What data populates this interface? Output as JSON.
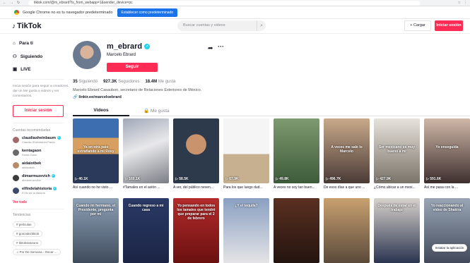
{
  "browser": {
    "url": "tiktok.com/@m_ebrard?is_from_webapp=1&sender_device=pc"
  },
  "infobar": {
    "text": "Google Chrome no es tu navegador predeterminado",
    "button": "Establecer como predeterminado"
  },
  "header": {
    "logo": "TikTok",
    "search_placeholder": "Buscar cuentas y videos",
    "upload": "+ Cargar",
    "login": "Iniciar sesión"
  },
  "sidebar": {
    "nav": [
      {
        "label": "Para ti",
        "icon": "home-icon"
      },
      {
        "label": "Siguiendo",
        "icon": "users-icon"
      },
      {
        "label": "LIVE",
        "icon": "live-icon"
      }
    ],
    "login_prompt": "Inicia sesión para seguir a creadores, dar un Me gusta a videos y ver comentarios.",
    "login_button": "Iniciar sesión",
    "recommended_title": "Cuentas recomendadas",
    "accounts": [
      {
        "name": "claudiasheinbaum",
        "sub": "Claudia Sheinbaum Pardo",
        "color": "#a06a6a",
        "verified": true
      },
      {
        "name": "kentagaon",
        "sub": "Kenta Gaon",
        "color": "#6a6a6a",
        "verified": false
      },
      {
        "name": "aidaiotbek",
        "sub": "aidaiotbek",
        "color": "#b58c6a",
        "verified": false
      },
      {
        "name": "dimarmuzevich",
        "sub": "dimarmuzevich",
        "color": "#3d3d3d",
        "verified": true
      },
      {
        "name": "elfindelahistoria",
        "sub": "El fin de la historia",
        "color": "#3a4a6a",
        "verified": true
      }
    ],
    "see_more": "Ver todo",
    "trends_title": "Tendencias",
    "tags": [
      "películas",
      "gonzaleztiktok",
      "tiktokseasons",
      "Por De Semana - Oscar ..."
    ]
  },
  "profile": {
    "username": "m_ebrard",
    "nickname": "Marcelo Ebrard",
    "follow": "Seguir",
    "following_count": "35",
    "following_label": "Siguiendo",
    "followers_count": "927.3K",
    "followers_label": "Seguidores",
    "likes_count": "18.4M",
    "likes_label": "Me gusta",
    "bio": "Marcelo Ebrard Casaubon, secretario de Relaciones Exteriores de México.",
    "link": "linktr.ee/marceloebrard"
  },
  "tabs": {
    "videos": "Videos",
    "liked": "Me gusta"
  },
  "videos_row1": [
    {
      "views": "40.1K",
      "caption": "Así cuando no he visto ...",
      "overlay": "Ya en otra pais extrañando a mi Rosy",
      "bg": "linear-gradient(#3d6fb0 0 30%, #d8a060 30% 55%, #2b3a5a 55%)"
    },
    {
      "views": "160.1K",
      "caption": "#Tamales en el avión ...",
      "overlay": "",
      "bg": "linear-gradient(160deg,#a0a8b8,#e8e8ea 45%,#7a7d85)"
    },
    {
      "views": "58.5K",
      "caption": "A ver, del público neven...",
      "overlay": "",
      "bg": "radial-gradient(circle at 50% 40%,#c9936e 0 22%,#2c3a4c 23%)"
    },
    {
      "views": "67.9K",
      "caption": "Para los que luego dud...",
      "overlay": "",
      "bg": "linear-gradient(#f5f5f5 0 55%,#c6b08f 55%)"
    },
    {
      "views": "49.8K",
      "caption": "A veces no soy tan buen...",
      "overlay": "",
      "bg": "linear-gradient(#7e9a70,#3d5b3a)"
    },
    {
      "views": "496.7K",
      "caption": "De esos días a que uno ...",
      "overlay": "A veces me sale lo Marcelo",
      "bg": "linear-gradient(#c9a98a,#4a3b36)"
    },
    {
      "views": "427.9K",
      "caption": "¿Cómo ubicar a un mexi...",
      "overlay": "Ser mexicano es muy bueno a mi",
      "bg": "linear-gradient(#e7e2dc,#7a7369)"
    },
    {
      "views": "591.6K",
      "caption": "Así me pasa con la ...",
      "overlay": "Yo enseguida",
      "bg": "linear-gradient(#d0b8a8,#3e2f2f)"
    }
  ],
  "videos_row2": [
    {
      "overlay": "Cuando mi hermano, el Presidente, pregunta por mi",
      "bg": "linear-gradient(#8da0b6,#3e4b5c)"
    },
    {
      "overlay": "Cuando regreso a mi casa",
      "bg": "linear-gradient(#2a3a66,#1b2444)"
    },
    {
      "overlay": "Yo pensando en todos los tamales que tendré que preparar para el 2 de febrero",
      "bg": "linear-gradient(#b52b2b,#6a1010)"
    },
    {
      "overlay": "¿Y el tequila?",
      "bg": "linear-gradient(#8aa0c2,#e4e4e6)"
    },
    {
      "overlay": "",
      "bg": "linear-gradient(#5a3020,#241410)"
    },
    {
      "overlay": "",
      "bg": "linear-gradient(#c8a070,#5a4a3a)"
    },
    {
      "overlay": "Después de estar en el trabajo",
      "bg": "linear-gradient(#d8d2cc,#2a3450)"
    },
    {
      "overlay": "Yo reaccionando al video de Shakira",
      "bg": "linear-gradient(#9aa6b6,#41495a)"
    }
  ],
  "open_app": "Instalar la aplicación"
}
